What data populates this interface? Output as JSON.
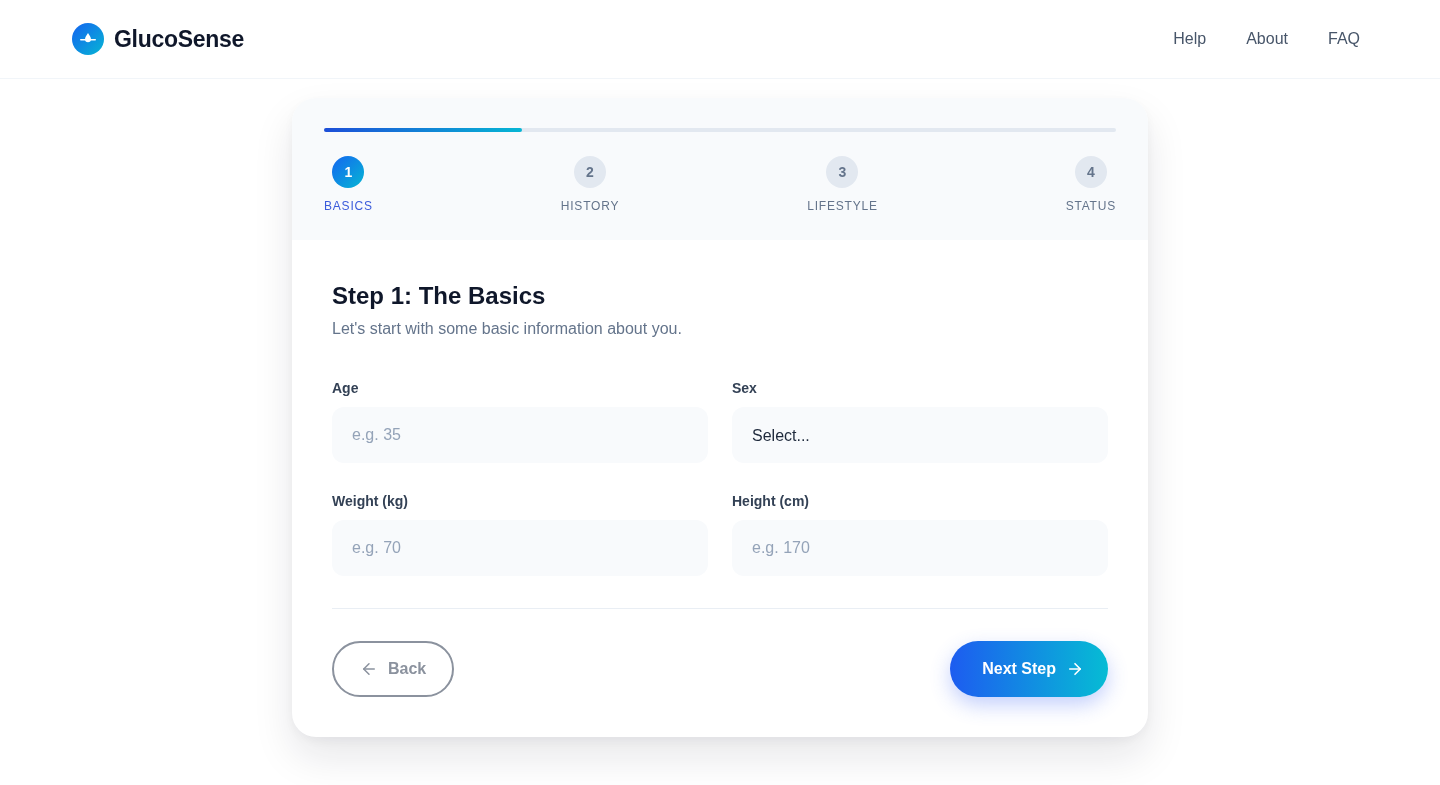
{
  "header": {
    "brand": "GlucoSense",
    "nav": [
      "Help",
      "About",
      "FAQ"
    ]
  },
  "progress": {
    "level": 0.25
  },
  "steps": [
    {
      "number": "1",
      "label": "BASICS",
      "selected": true
    },
    {
      "number": "2",
      "label": "HISTORY",
      "selected": false
    },
    {
      "number": "3",
      "label": "LIFESTYLE",
      "selected": false
    },
    {
      "number": "4",
      "label": "STATUS",
      "selected": false
    }
  ],
  "form": {
    "title": "Step 1: The Basics",
    "subtitle": "Let's start with some basic information about you.",
    "fields": [
      {
        "kind": "input",
        "label": "Age",
        "placeholder": "e.g. 35"
      },
      {
        "kind": "select",
        "label": "Sex",
        "value": "Select..."
      },
      {
        "kind": "input",
        "label": "Weight (kg)",
        "placeholder": "e.g. 70"
      },
      {
        "kind": "input",
        "label": "Height (cm)",
        "placeholder": "e.g. 170"
      }
    ]
  },
  "actions": {
    "back": {
      "label": "Back",
      "disabled": true
    },
    "next": {
      "label": "Next Step"
    }
  }
}
